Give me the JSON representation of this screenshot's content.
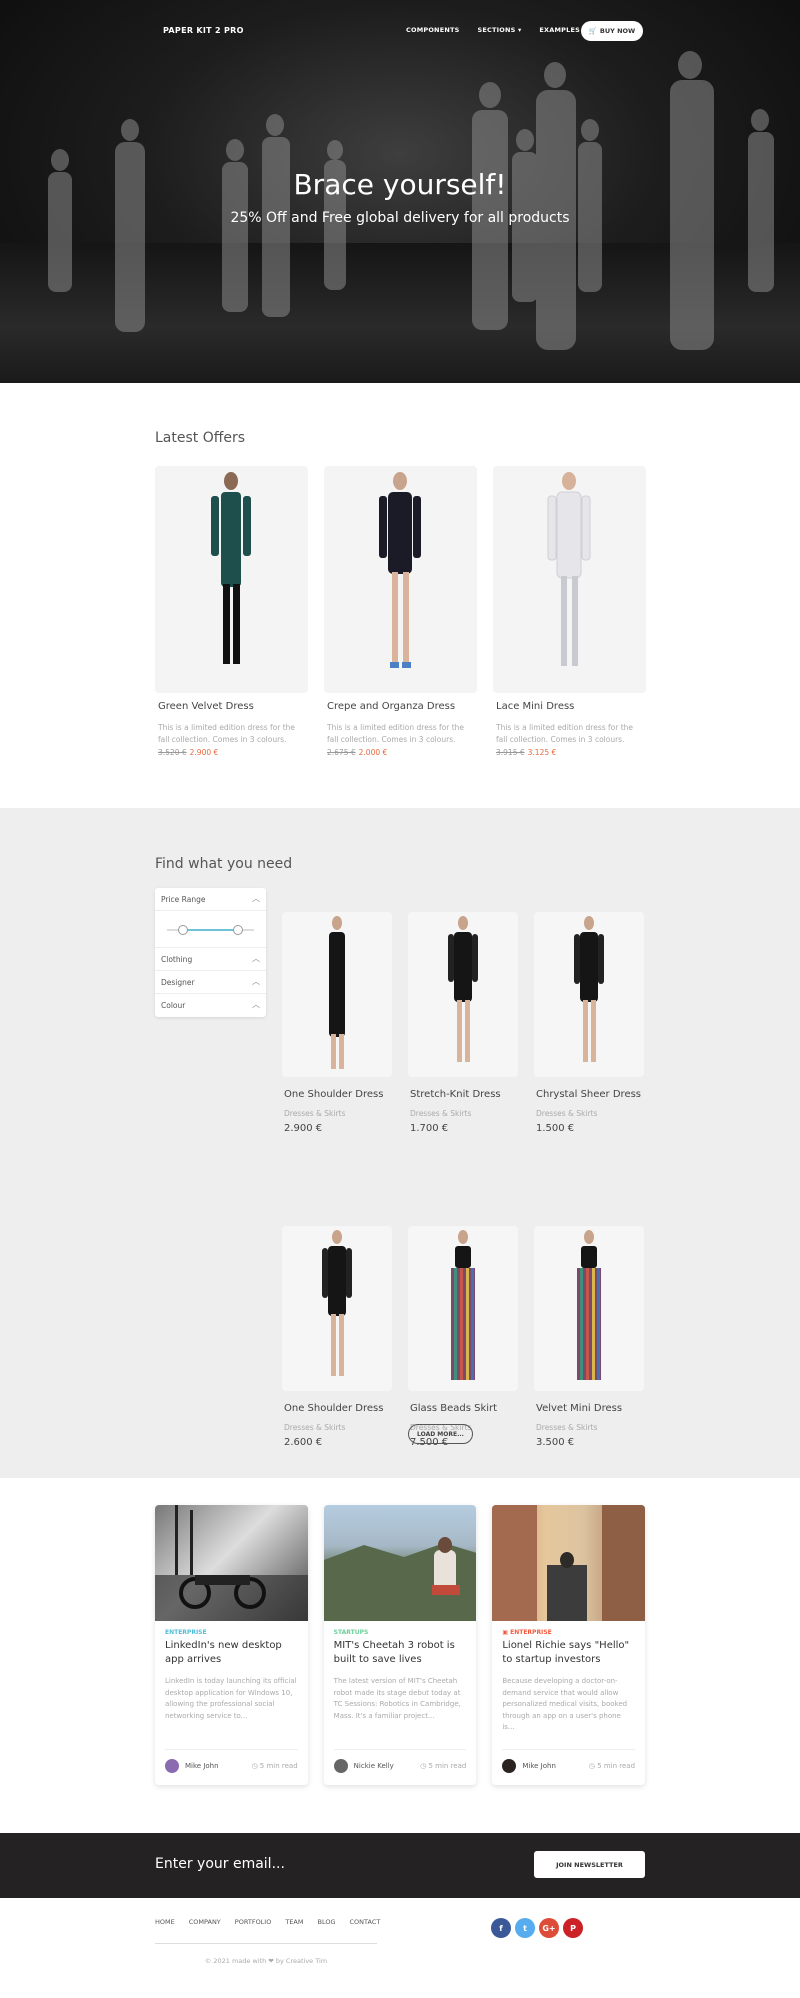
{
  "nav": {
    "brand": "PAPER KIT 2 PRO",
    "links": [
      "COMPONENTS",
      "SECTIONS ▾",
      "EXAMPLES ▾"
    ],
    "buy_label": "BUY NOW"
  },
  "hero": {
    "title": "Brace yourself!",
    "subtitle": "25% Off and Free global delivery for all products"
  },
  "offers": {
    "title": "Latest Offers",
    "items": [
      {
        "name": "Green Velvet Dress",
        "desc": "This is a limited edition dress for the fall collection. Comes in 3 colours.",
        "old_price": "3.520 €",
        "new_price": "2.900 €",
        "color": "#1f4f4c"
      },
      {
        "name": "Crepe and Organza Dress",
        "desc": "This is a limited edition dress for the fall collection. Comes in 3 colours.",
        "old_price": "2.675 €",
        "new_price": "2.000 €",
        "color": "#1a1b26"
      },
      {
        "name": "Lace Mini Dress",
        "desc": "This is a limited edition dress for the fall collection. Comes in 3 colours.",
        "old_price": "3.915 €",
        "new_price": "3.125 €",
        "color": "#e6e6ea"
      }
    ]
  },
  "find": {
    "title": "Find what you need",
    "filters": [
      "Price Range",
      "Clothing",
      "Designer",
      "Colour"
    ],
    "products": [
      {
        "name": "One Shoulder Dress",
        "cat": "Dresses & Skirts",
        "price": "2.900 €"
      },
      {
        "name": "Stretch-Knit Dress",
        "cat": "Dresses & Skirts",
        "price": "1.700 €"
      },
      {
        "name": "Chrystal Sheer Dress",
        "cat": "Dresses & Skirts",
        "price": "1.500 €"
      },
      {
        "name": "One Shoulder Dress",
        "cat": "Dresses & Skirts",
        "price": "2.600 €"
      },
      {
        "name": "Glass Beads Skirt",
        "cat": "Dresses & Skirts",
        "price": "7.500 €"
      },
      {
        "name": "Velvet Mini Dress",
        "cat": "Dresses & Skirts",
        "price": "3.500 €"
      }
    ],
    "load_more": "LOAD MORE..."
  },
  "blog": {
    "posts": [
      {
        "cat": "ENTERPRISE",
        "cat_color": "#51bcda",
        "title": "LinkedIn's new desktop app arrives",
        "desc": "LinkedIn is today launching its official desktop application for Windows 10, allowing the professional social networking service to...",
        "author": "Mike John",
        "read": "5 min read"
      },
      {
        "cat": "STARTUPS",
        "cat_color": "#6bd098",
        "title": "MIT's Cheetah 3 robot is built to save lives",
        "desc": "The latest version of MIT's Cheetah robot made its stage debut today at TC Sessions: Robotics in Cambridge, Mass. It's a familiar project...",
        "author": "Nickie Kelly",
        "read": "5 min read"
      },
      {
        "cat": "ENTERPRISE",
        "cat_color": "#f5593d",
        "title": "Lionel Richie says \"Hello\" to startup investors",
        "desc": "Because developing a doctor-on-demand service that would allow personalized medical visits, booked through an app on a user's phone is...",
        "author": "Mike John",
        "read": "5 min read"
      }
    ]
  },
  "newsletter": {
    "placeholder": "Enter your email...",
    "button": "JOIN NEWSLETTER"
  },
  "footer": {
    "links": [
      "HOME",
      "COMPANY",
      "PORTFOLIO",
      "TEAM",
      "BLOG",
      "CONTACT"
    ],
    "copyright": "© 2021 made with ❤ by Creative Tim",
    "socials": [
      {
        "glyph": "f",
        "color": "#3b5998"
      },
      {
        "glyph": "t",
        "color": "#55acee"
      },
      {
        "glyph": "G+",
        "color": "#dd4b39"
      },
      {
        "glyph": "P",
        "color": "#cc2127"
      }
    ]
  }
}
